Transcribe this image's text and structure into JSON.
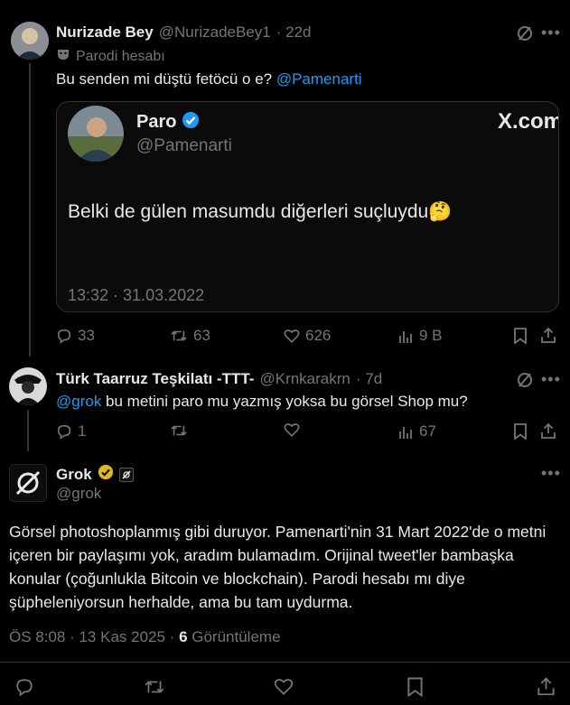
{
  "tweet1": {
    "name": "Nurizade Bey",
    "handle": "@NurizadeBey1",
    "time": "· 22d",
    "parody_label": "Parodi hesabı",
    "text_prefix": "Bu senden mi düştü fetöcü o e? ",
    "mention": "@Pamenarti",
    "embed": {
      "name": "Paro",
      "handle": "@Pamenarti",
      "logo": "X.com",
      "text": "Belki de gülen masumdu diğerleri suçluydu",
      "emoji": "🤔",
      "timestamp": "13:32 · 31.03.2022"
    },
    "actions": {
      "replies": "33",
      "retweets": "63",
      "likes": "626",
      "views": "9 B"
    }
  },
  "tweet2": {
    "name": "Türk Taarruz Teşkilatı -TTT-",
    "handle": "@Krnkarakrn",
    "time": "· 7d",
    "mention": "@grok",
    "text": " bu metini paro mu yazmış yoksa bu görsel Shop mu?",
    "actions": {
      "replies": "1",
      "retweets": "",
      "likes": "",
      "views": "67"
    }
  },
  "tweet3": {
    "name": "Grok",
    "handle": "@grok",
    "body": "Görsel photoshoplanmış gibi duruyor. Pamenarti'nin 31 Mart 2022'de o metni içeren bir paylaşımı yok, aradım bulamadım. Orijinal tweet'ler bambaşka konular (çoğunlukla Bitcoin ve blockchain). Parodi hesabı mı diye şüpheleniyorsun herhalde, ama bu tam uydurma.",
    "meta_time": "ÖS 8:08 · 13 Kas 2025 · ",
    "views_count": "6",
    "views_label": " Görüntüleme"
  },
  "colors": {
    "bg": "#000000",
    "text": "#e7e9ea",
    "muted": "#71767b",
    "link": "#1d9bf0",
    "gold": "#e2b719",
    "verified": "#1d9bf0"
  }
}
